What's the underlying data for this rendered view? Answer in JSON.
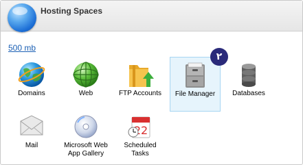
{
  "header": {
    "title": "Hosting Spaces"
  },
  "quota": {
    "link": "500 mb"
  },
  "badge": {
    "text": "۲"
  },
  "tiles": [
    {
      "label": "Domains",
      "icon": "domains-globe-icon"
    },
    {
      "label": "Web",
      "icon": "web-globe-icon"
    },
    {
      "label": "FTP Accounts",
      "icon": "ftp-folder-icon"
    },
    {
      "label": "File Manager",
      "icon": "file-cabinet-icon"
    },
    {
      "label": "Databases",
      "icon": "database-icon"
    },
    {
      "label": "Mail",
      "icon": "mail-envelope-icon"
    },
    {
      "label": "Microsoft Web App Gallery",
      "icon": "web-app-gallery-disc-icon"
    },
    {
      "label": "Scheduled Tasks",
      "icon": "calendar-icon"
    }
  ]
}
